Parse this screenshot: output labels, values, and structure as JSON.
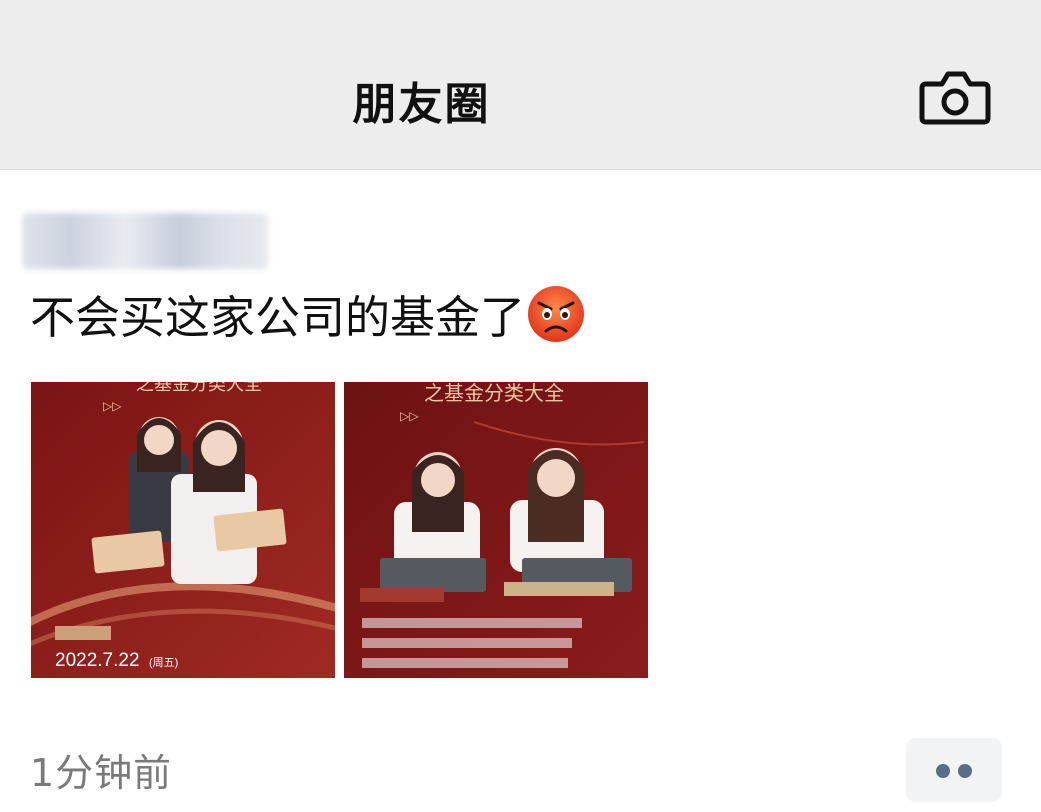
{
  "header": {
    "title": "朋友圈",
    "camera_icon": "camera-icon"
  },
  "post": {
    "text": "不会买这家公司的基金了",
    "emoji": "angry-face-emoji",
    "images": [
      {
        "banner": "之基金分类大全",
        "date": "2022.7.22",
        "date_suffix": "(周五)"
      },
      {
        "banner": "之基金分类大全"
      }
    ],
    "timestamp": "1分钟前",
    "more_icon": "more-dots-icon"
  },
  "colors": {
    "header_bg": "#ededed",
    "image_red": "#8c1c1c",
    "link_blue": "#5a6b8c"
  }
}
